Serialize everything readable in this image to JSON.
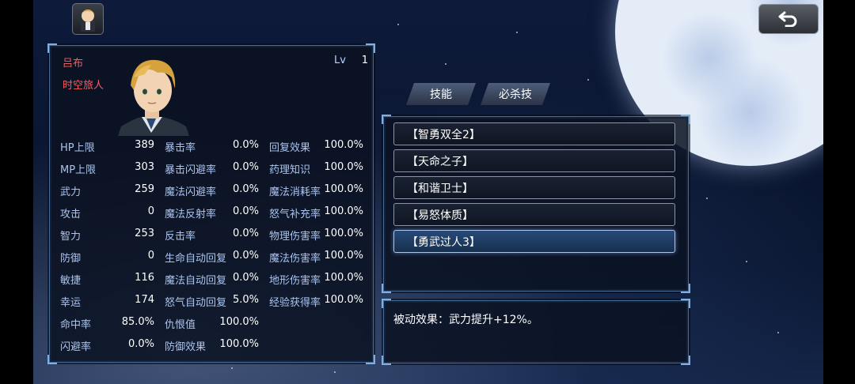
{
  "character": {
    "name": "吕布",
    "title": "时空旅人",
    "lv_label": "Lv",
    "lv_value": "1"
  },
  "stats_col1": [
    {
      "label": "HP上限",
      "value": "389"
    },
    {
      "label": "MP上限",
      "value": "303"
    },
    {
      "label": "武力",
      "value": "259"
    },
    {
      "label": "攻击",
      "value": "0"
    },
    {
      "label": "智力",
      "value": "253"
    },
    {
      "label": "防御",
      "value": "0"
    },
    {
      "label": "敏捷",
      "value": "116"
    },
    {
      "label": "幸运",
      "value": "174"
    },
    {
      "label": "命中率",
      "value": "85.0%"
    },
    {
      "label": "闪避率",
      "value": "0.0%"
    }
  ],
  "stats_col2": [
    {
      "label": "暴击率",
      "value": "0.0%"
    },
    {
      "label": "暴击闪避率",
      "value": "0.0%"
    },
    {
      "label": "魔法闪避率",
      "value": "0.0%"
    },
    {
      "label": "魔法反射率",
      "value": "0.0%"
    },
    {
      "label": "反击率",
      "value": "0.0%"
    },
    {
      "label": "生命自动回复",
      "value": "0.0%"
    },
    {
      "label": "魔法自动回复",
      "value": "0.0%"
    },
    {
      "label": "怒气自动回复",
      "value": "5.0%"
    },
    {
      "label": "仇恨值",
      "value": "100.0%"
    },
    {
      "label": "防御效果",
      "value": "100.0%"
    }
  ],
  "stats_col3": [
    {
      "label": "回复效果",
      "value": "100.0%"
    },
    {
      "label": "药理知识",
      "value": "100.0%"
    },
    {
      "label": "魔法消耗率",
      "value": "100.0%"
    },
    {
      "label": "怒气补充率",
      "value": "100.0%"
    },
    {
      "label": "物理伤害率",
      "value": "100.0%"
    },
    {
      "label": "魔法伤害率",
      "value": "100.0%"
    },
    {
      "label": "地形伤害率",
      "value": "100.0%"
    },
    {
      "label": "经验获得率",
      "value": "100.0%"
    }
  ],
  "tabs": {
    "skills": "技能",
    "ultimate": "必杀技"
  },
  "skills": [
    "【智勇双全2】",
    "【天命之子】",
    "【和谐卫士】",
    "【易怒体质】",
    "【勇武过人3】"
  ],
  "selected_skill_index": 4,
  "description": "被动效果：武力提升+12%。"
}
